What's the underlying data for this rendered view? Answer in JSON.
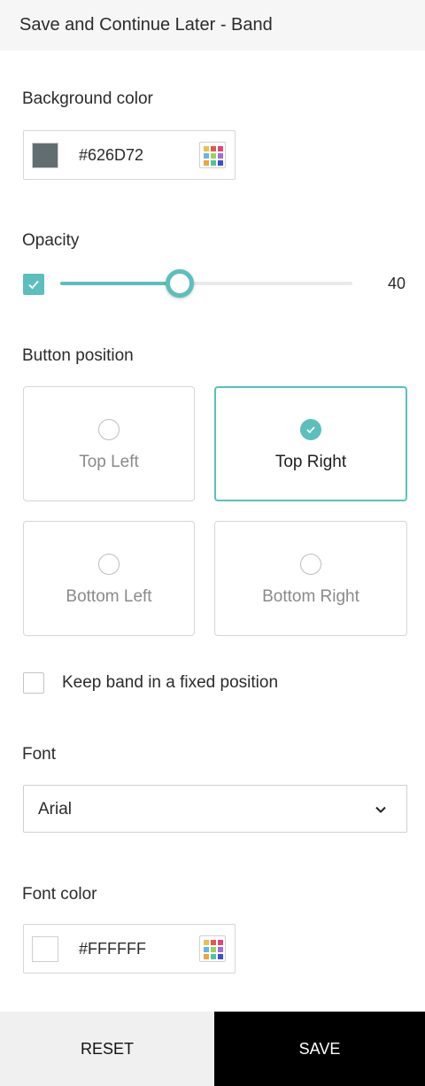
{
  "header": {
    "title": "Save and Continue Later - Band"
  },
  "background_color": {
    "label": "Background color",
    "hex": "#626D72",
    "swatch_color": "#626D72"
  },
  "opacity": {
    "label": "Opacity",
    "enabled": true,
    "value": "40",
    "percent": 0.41
  },
  "button_position": {
    "label": "Button position",
    "options": [
      {
        "label": "Top Left",
        "selected": false
      },
      {
        "label": "Top Right",
        "selected": true
      },
      {
        "label": "Bottom Left",
        "selected": false
      },
      {
        "label": "Bottom Right",
        "selected": false
      }
    ]
  },
  "fixed_position": {
    "label": "Keep band in a fixed position",
    "checked": false
  },
  "font": {
    "label": "Font",
    "selected": "Arial",
    "icon": "chevron-down-icon"
  },
  "font_color": {
    "label": "Font color",
    "hex": "#FFFFFF",
    "swatch_color": "#FFFFFF"
  },
  "palette_colors": [
    "#e8c24a",
    "#e05b4b",
    "#d94a7a",
    "#62b7e8",
    "#9bd35a",
    "#a46bd6",
    "#f0a43a",
    "#4fc3a1",
    "#3a4fd6"
  ],
  "accent_color": "#5cbfbd",
  "footer": {
    "reset_label": "RESET",
    "save_label": "SAVE"
  }
}
